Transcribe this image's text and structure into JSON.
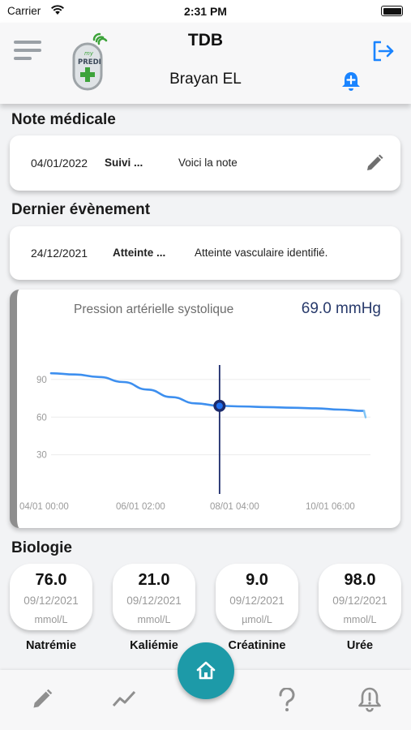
{
  "status_bar": {
    "carrier": "Carrier",
    "time": "2:31 PM"
  },
  "header": {
    "title": "TDB",
    "user": "Brayan EL"
  },
  "medical_note": {
    "section_title": "Note médicale",
    "date": "04/01/2022",
    "type": "Suivi ...",
    "text": "Voici la note"
  },
  "last_event": {
    "section_title": "Dernier évènement",
    "date": "24/12/2021",
    "type": "Atteinte ...",
    "text": "Atteinte vasculaire identifié."
  },
  "chart": {
    "header_label": "Pression artérielle systolique",
    "current_value": "69.0 mmHg"
  },
  "chart_data": {
    "type": "line",
    "title": "",
    "xlabel": "",
    "ylabel": "",
    "y_ticks": [
      "90",
      "60",
      "30"
    ],
    "x_ticks": [
      "04/01  00:00",
      "06/01  02:00",
      "08/01  04:00",
      "10/01  06:00"
    ],
    "ylim": [
      0,
      110
    ],
    "x": [
      0,
      0.5,
      1,
      1.5,
      2,
      2.5,
      3,
      3.5,
      4,
      4.5,
      5,
      5.5,
      6,
      6.5
    ],
    "series": [
      {
        "values": [
          95,
          94,
          92,
          88,
          82,
          76,
          71,
          69,
          68.5,
          68,
          67.5,
          67,
          66,
          65
        ]
      }
    ],
    "selected_point": {
      "x": 3.5,
      "y": 69
    },
    "grid": true,
    "line_color": "#3d8fef",
    "cursor_color": "#1c2a6b"
  },
  "biology": {
    "section_title": "Biologie",
    "items": [
      {
        "value": "76.0",
        "date": "09/12/2021",
        "unit": "mmol/L",
        "label": "Natrémie"
      },
      {
        "value": "21.0",
        "date": "09/12/2021",
        "unit": "mmol/L",
        "label": "Kaliémie"
      },
      {
        "value": "9.0",
        "date": "09/12/2021",
        "unit": "µmol/L",
        "label": "Créatinine"
      },
      {
        "value": "98.0",
        "date": "09/12/2021",
        "unit": "mmol/L",
        "label": "Urée"
      }
    ]
  },
  "icons": {
    "menu": "menu-icon",
    "logout": "logout-icon",
    "bell_add": "bell-plus-icon",
    "edit": "pencil-icon",
    "nav_edit": "pencil-icon",
    "nav_chart": "trend-icon",
    "nav_home": "home-icon",
    "nav_help": "question-icon",
    "nav_alert": "bell-alert-icon"
  },
  "colors": {
    "accent": "#1d9aa8",
    "link_blue": "#1a84ff",
    "logo_green": "#3da33a"
  }
}
